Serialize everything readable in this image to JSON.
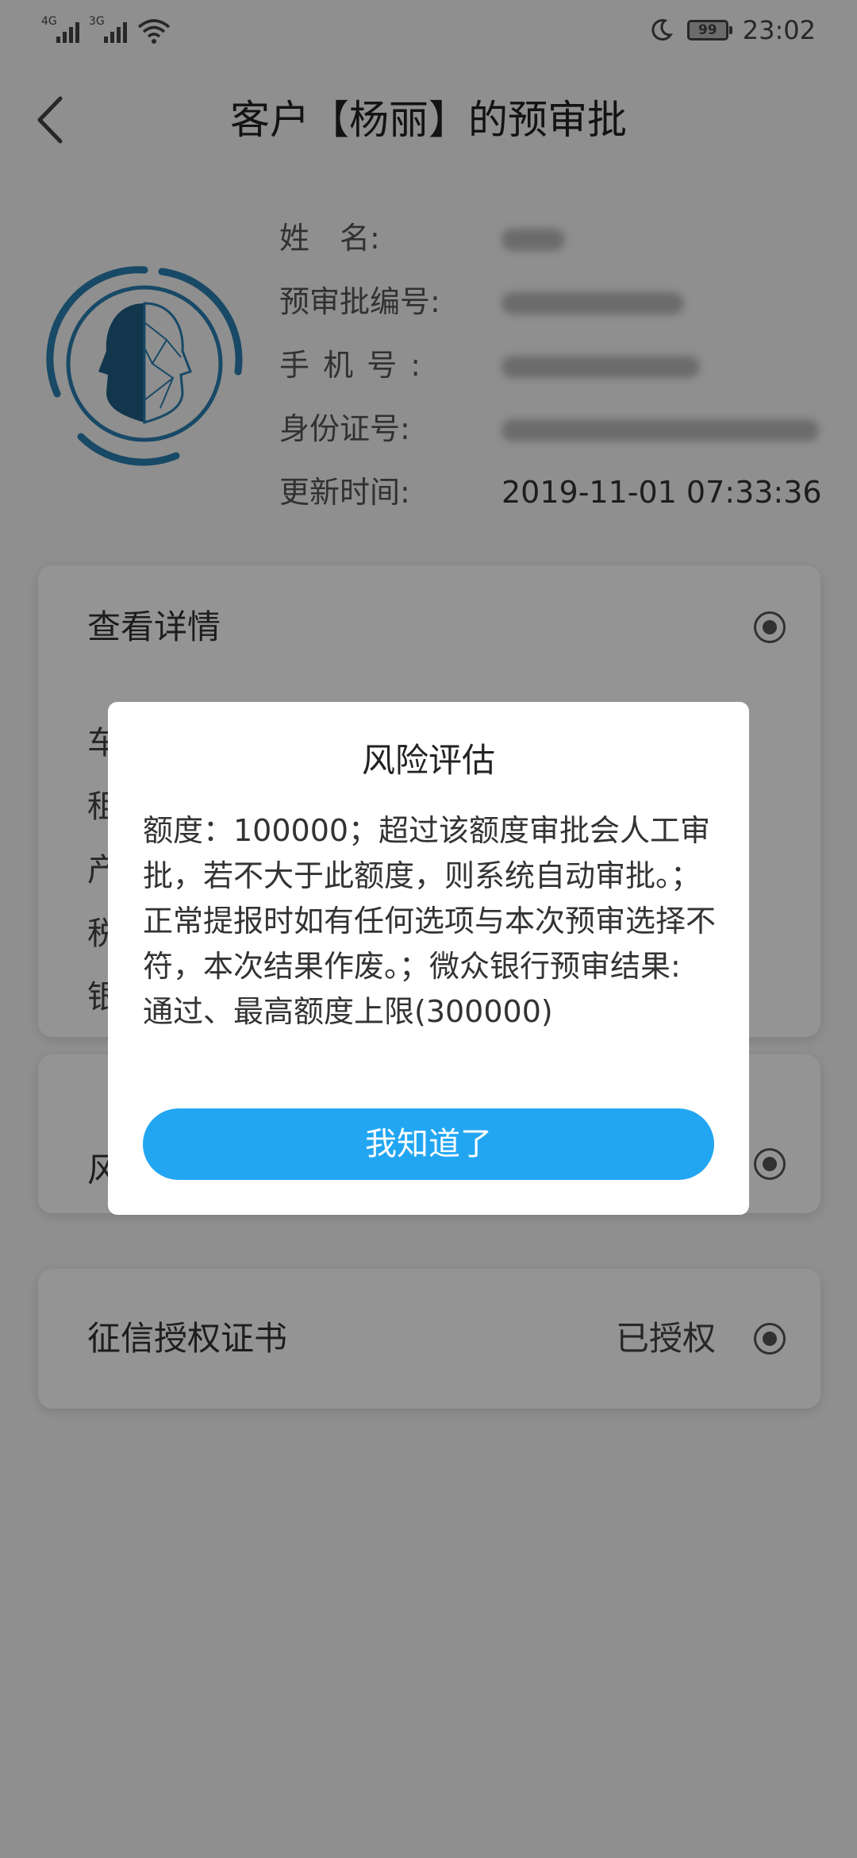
{
  "status_bar": {
    "signal_1_label": "4G",
    "signal_2_label": "3G",
    "battery_level": "99",
    "time": "23:02"
  },
  "header": {
    "title": "客户【杨丽】的预审批",
    "back_icon": "chevron-left-icon"
  },
  "profile": {
    "name_label": "姓　名:",
    "approval_no_label": "预审批编号:",
    "phone_label": "手机号:",
    "id_label": "身份证号:",
    "update_time_label": "更新时间:",
    "update_time_value": "2019-11-01 07:33:36"
  },
  "cards": {
    "details_title": "查看详情",
    "risk_partial": "风",
    "credit_title": "征信授权证书",
    "credit_status": "已授权",
    "detail_rows": [
      "车",
      "租",
      "产",
      "税",
      "银"
    ]
  },
  "dialog": {
    "title": "风险评估",
    "body": "额度：100000；超过该额度审批会人工审批，若不大于此额度，则系统自动审批。；正常提报时如有任何选项与本次预审选择不符，本次结果作废。；微众银行预审结果: 通过、最高额度上限(300000)",
    "button_label": "我知道了"
  },
  "colors": {
    "accent": "#22a6f2",
    "badge_blue": "#2a7fb0"
  }
}
